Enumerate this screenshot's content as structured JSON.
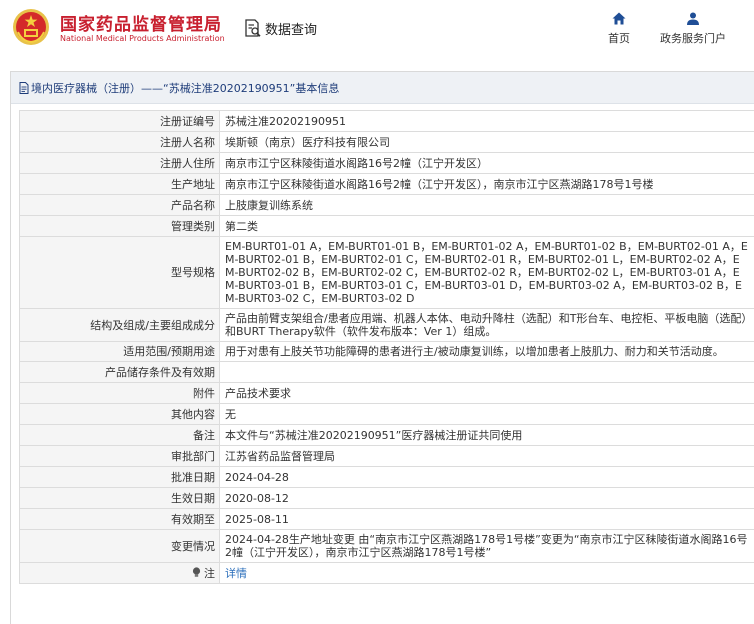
{
  "header": {
    "site_name_cn": "国家药品监督管理局",
    "site_name_en": "National Medical Products Administration",
    "data_query": "数据查询",
    "nav": [
      {
        "label": "首页",
        "icon": "home-icon"
      },
      {
        "label": "政务服务门户",
        "icon": "user-icon"
      }
    ]
  },
  "title": {
    "icon": "document-icon",
    "text": "境内医疗器械（注册）——“苏械注准20202190951”基本信息"
  },
  "rows": [
    {
      "label": "注册证编号",
      "value": "苏械注准20202190951"
    },
    {
      "label": "注册人名称",
      "value": "埃斯顿（南京）医疗科技有限公司"
    },
    {
      "label": "注册人住所",
      "value": "南京市江宁区秣陵街道水阁路16号2幢（江宁开发区）"
    },
    {
      "label": "生产地址",
      "value": "南京市江宁区秣陵街道水阁路16号2幢（江宁开发区），南京市江宁区燕湖路178号1号楼"
    },
    {
      "label": "产品名称",
      "value": "上肢康复训练系统"
    },
    {
      "label": "管理类别",
      "value": "第二类"
    },
    {
      "label": "型号规格",
      "value": "EM-BURT01-01 A，EM-BURT01-01 B，EM-BURT01-02 A，EM-BURT01-02 B，EM-BURT02-01 A，EM-BURT02-01 B，EM-BURT02-01 C，EM-BURT02-01 R，EM-BURT02-01 L，EM-BURT02-02 A，EM-BURT02-02 B，EM-BURT02-02 C，EM-BURT02-02 R，EM-BURT02-02 L，EM-BURT03-01 A，EM-BURT03-01 B，EM-BURT03-01 C，EM-BURT03-01 D，EM-BURT03-02 A，EM-BURT03-02 B，EM-BURT03-02 C，EM-BURT03-02 D"
    },
    {
      "label": "结构及组成/主要组成成分",
      "value": "产品由前臂支架组合/患者应用端、机器人本体、电动升降柱（选配）和T形台车、电控柜、平板电脑（选配）和BURT Therapy软件（软件发布版本：Ver 1）组成。"
    },
    {
      "label": "适用范围/预期用途",
      "value": "用于对患有上肢关节功能障碍的患者进行主/被动康复训练，以增加患者上肢肌力、耐力和关节活动度。"
    },
    {
      "label": "产品储存条件及有效期",
      "value": ""
    },
    {
      "label": "附件",
      "value": "产品技术要求"
    },
    {
      "label": "其他内容",
      "value": "无"
    },
    {
      "label": "备注",
      "value": "本文件与“苏械注准20202190951”医疗器械注册证共同使用"
    },
    {
      "label": "审批部门",
      "value": "江苏省药品监督管理局"
    },
    {
      "label": "批准日期",
      "value": "2024-04-28"
    },
    {
      "label": "生效日期",
      "value": "2020-08-12"
    },
    {
      "label": "有效期至",
      "value": "2025-08-11"
    },
    {
      "label": "变更情况",
      "value": "2024-04-28生产地址变更 由“南京市江宁区燕湖路178号1号楼”变更为“南京市江宁区秣陵街道水阁路16号2幢（江宁开发区），南京市江宁区燕湖路178号1号楼”"
    }
  ],
  "note_row": {
    "icon": "lightbulb-icon",
    "label": "注",
    "link": "详情"
  },
  "colors": {
    "brand_red": "#c8202f",
    "nav_blue": "#1f4e96",
    "link_blue": "#2a6ebb"
  }
}
